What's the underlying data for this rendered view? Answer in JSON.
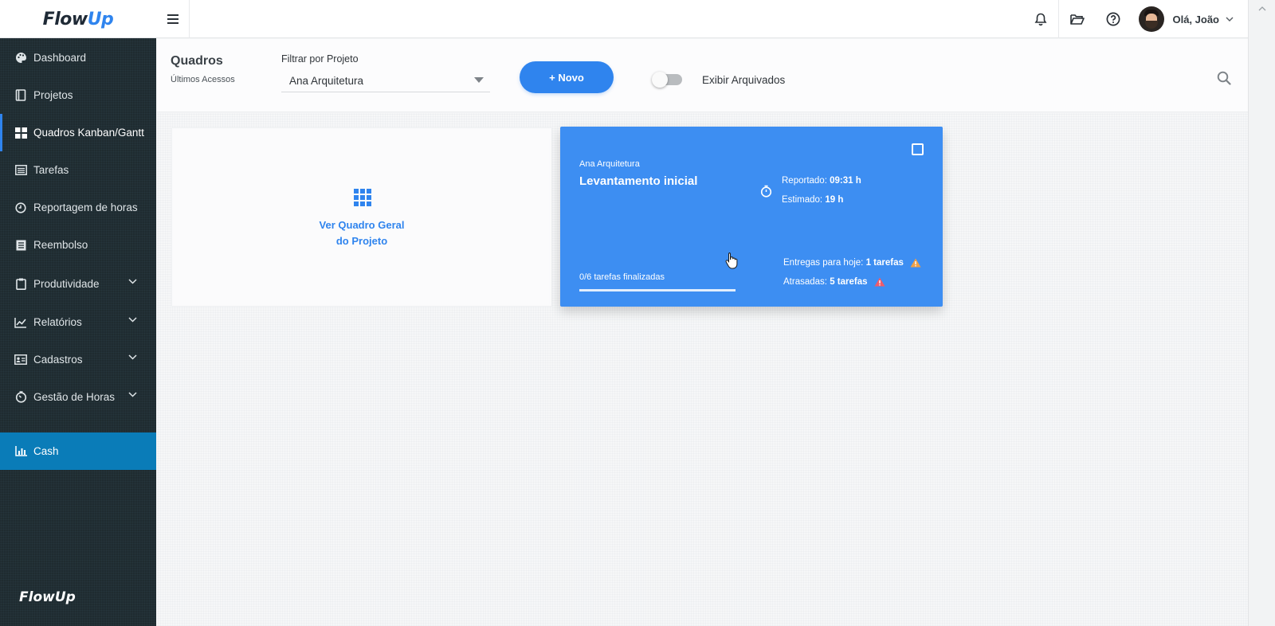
{
  "brand": {
    "flow": "Flow",
    "up": "Up"
  },
  "topbar": {
    "menu_icon": "hamburger-icon",
    "icons": [
      "bell-icon",
      "folder-open-icon",
      "help-circle-icon"
    ],
    "user_greeting": "Olá, João"
  },
  "sidebar": {
    "items": [
      {
        "label": "Dashboard",
        "icon": "palette-icon"
      },
      {
        "label": "Projetos",
        "icon": "book-icon"
      },
      {
        "label": "Quadros Kanban/Gantt",
        "icon": "grid-icon",
        "active": true
      },
      {
        "label": "Tarefas",
        "icon": "list-icon"
      },
      {
        "label": "Reportagem de horas",
        "icon": "clock-icon"
      },
      {
        "label": "Reembolso",
        "icon": "document-icon"
      },
      {
        "label": "Produtividade",
        "icon": "clipboard-icon",
        "expandable": true
      },
      {
        "label": "Relatórios",
        "icon": "line-chart-icon",
        "expandable": true
      },
      {
        "label": "Cadastros",
        "icon": "id-card-icon",
        "expandable": true
      },
      {
        "label": "Gestão de Horas",
        "icon": "stopwatch-icon",
        "expandable": true
      },
      {
        "label": "Cash",
        "icon": "bar-chart-icon",
        "highlighted": true
      }
    ],
    "footer_brand": "FlowUp"
  },
  "header": {
    "title": "Quadros",
    "subtitle": "Últimos Acessos",
    "filter_label": "Filtrar por Projeto",
    "filter_value": "Ana Arquitetura",
    "new_button": "+ Novo",
    "toggle_label": "Exibir Arquivados",
    "toggle_on": false
  },
  "overview_card": {
    "line1": "Ver Quadro Geral",
    "line2": "do Projeto",
    "icon": "apps-grid-icon"
  },
  "board_card": {
    "project": "Ana Arquitetura",
    "title": "Levantamento inicial",
    "reported_label": "Reportado:",
    "reported_value": "09:31 h",
    "estimated_label": "Estimado:",
    "estimated_value": "19 h",
    "tasks_done_text": "0/6 tarefas finalizadas",
    "progress": 0,
    "due_today_label": "Entregas para hoje:",
    "due_today_value": "1 tarefas",
    "late_label": "Atrasadas:",
    "late_value": "5 tarefas",
    "colors": {
      "card": "#3d8ef2",
      "warn_orange": "#f0a046",
      "warn_red": "#ef5b6b"
    }
  },
  "colors": {
    "accent": "#2f84ee",
    "sidebar_bg": "#1f2b30",
    "cash_bg": "#0a7cb8"
  }
}
